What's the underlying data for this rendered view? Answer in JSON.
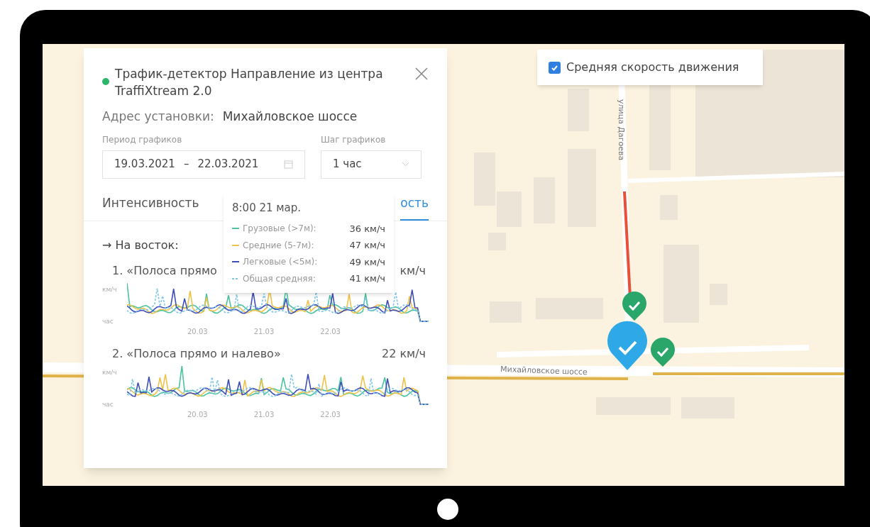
{
  "panel": {
    "title": "Трафик-детектор Направление из центра TraffiXtream 2.0",
    "address_label": "Адрес установки:",
    "address": "Михайловское шоссе",
    "period": {
      "label": "Период графиков",
      "from": "19.03.2021",
      "separator": "–",
      "to": "22.03.2021"
    },
    "step": {
      "label": "Шаг графиков",
      "value": "1 час"
    },
    "tabs": [
      {
        "label": "Интенсивность",
        "selected": false
      },
      {
        "label": "ость",
        "selected": true
      }
    ],
    "direction": "→ На восток:",
    "lanes": [
      {
        "title": "1. «Полоса прямо",
        "value": "км/ч",
        "y_unit": "км/ч",
        "x_unit": "час",
        "x_labels": [
          "20.03",
          "21.03",
          "22.03"
        ]
      },
      {
        "title": "2. «Полоса прямо и налево»",
        "value": "22 км/ч",
        "y_unit": "км/ч",
        "x_unit": "час",
        "x_labels": [
          "20.03",
          "21.03",
          "22.03"
        ]
      }
    ]
  },
  "tooltip": {
    "time": "8:00 21 мар.",
    "items": [
      {
        "label": "Грузовые (>7м):",
        "value": "36 км/ч",
        "color": "#4cc4a0",
        "kind": "solid"
      },
      {
        "label": "Средние (5-7м):",
        "value": "47 км/ч",
        "color": "#eec24a",
        "kind": "solid"
      },
      {
        "label": "Легковые (<5м):",
        "value": "49 км/ч",
        "color": "#3f4fb8",
        "kind": "solid"
      },
      {
        "label": "Общая средняя:",
        "value": "41 км/ч",
        "color": "#7ec6ea",
        "kind": "dashed"
      }
    ]
  },
  "layer_toggle": {
    "label": "Средняя скорость движения",
    "checked": true
  },
  "map": {
    "street_labels": [
      "улица Дагоева",
      "Михайловское шоссе"
    ]
  }
}
